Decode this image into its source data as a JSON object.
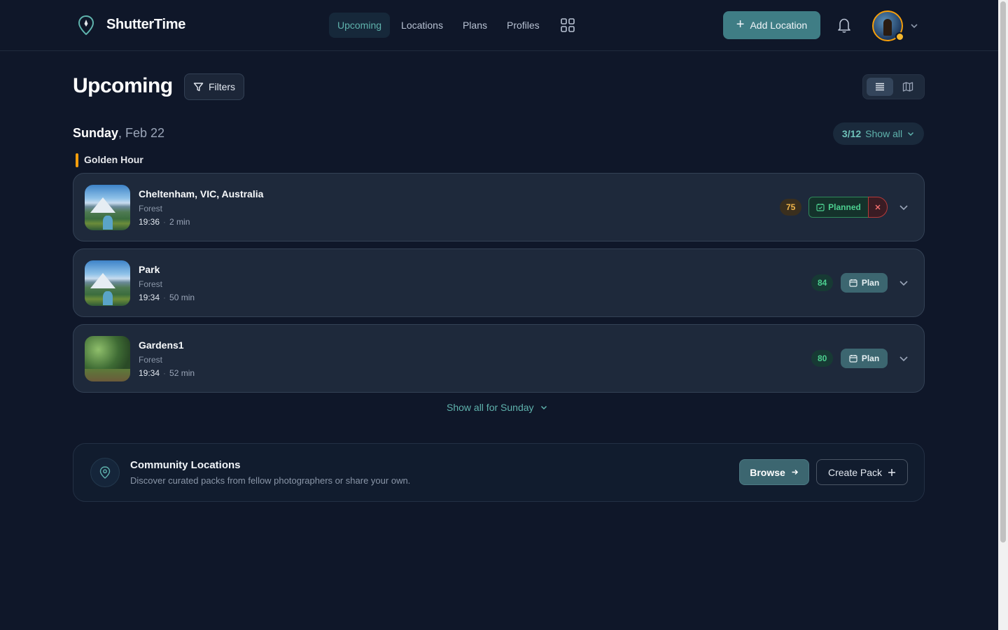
{
  "app": {
    "name": "ShutterTime"
  },
  "nav": {
    "items": [
      {
        "label": "Upcoming",
        "active": true
      },
      {
        "label": "Locations",
        "active": false
      },
      {
        "label": "Plans",
        "active": false
      },
      {
        "label": "Profiles",
        "active": false
      }
    ],
    "grid_icon": "grid-icon"
  },
  "header": {
    "add_location_label": "Add Location",
    "notifications_icon": "bell-icon",
    "avatar_icon": "user-avatar"
  },
  "page": {
    "title": "Upcoming",
    "filters_label": "Filters",
    "view_modes": [
      "list",
      "map"
    ],
    "active_view": "list"
  },
  "day": {
    "weekday": "Sunday",
    "date": ", Feb 22",
    "count": "3/12",
    "show_all_label": "Show all",
    "section": "Golden Hour",
    "show_more_label": "Show all for Sunday"
  },
  "locations": [
    {
      "name": "Cheltenham, VIC, Australia",
      "type": "Forest",
      "time": "19:36",
      "duration": "2 min",
      "score": "75",
      "score_color": "#f0b54a",
      "status": "Planned",
      "thumb": "mountain-valley"
    },
    {
      "name": "Park",
      "type": "Forest",
      "time": "19:34",
      "duration": "50 min",
      "score": "84",
      "score_color": "#4ccf8f",
      "status": "Plan",
      "thumb": "mountain-valley"
    },
    {
      "name": "Gardens1",
      "type": "Forest",
      "time": "19:34",
      "duration": "52 min",
      "score": "80",
      "score_color": "#4ccf8f",
      "status": "Plan",
      "thumb": "garden-trees"
    }
  ],
  "community": {
    "title": "Community Locations",
    "description": "Discover curated packs from fellow photographers or share your own.",
    "browse_label": "Browse",
    "create_label": "Create Pack"
  },
  "colors": {
    "background": "#0f1729",
    "card": "#1e293b",
    "accent": "#5fb3ad",
    "primary_button": "#3f7d85",
    "golden_hour": "#f59e0b"
  }
}
